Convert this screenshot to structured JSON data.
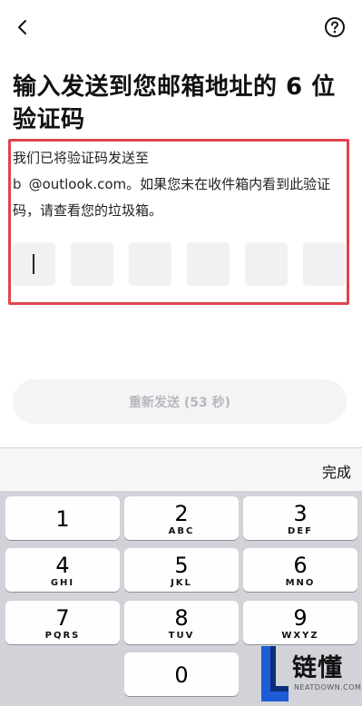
{
  "header": {
    "back_icon": "chevron-left-icon",
    "help_icon": "question-circle-icon"
  },
  "title": "输入发送到您邮箱地址的 6 位验证码",
  "description": {
    "line1": "我们已将验证码发送至",
    "email_masked": "b      ",
    "email_domain": "@outlook.com",
    "rest": "。如果您未在收件箱内看到此验证码，请查看您的垃圾箱。"
  },
  "code": {
    "length": 6,
    "values": [
      "",
      "",
      "",
      "",
      "",
      ""
    ]
  },
  "resend_button": "重新发送 (53 秒)",
  "keyboard": {
    "done": "完成",
    "keys": [
      {
        "num": "1",
        "letters": ""
      },
      {
        "num": "2",
        "letters": "ABC"
      },
      {
        "num": "3",
        "letters": "DEF"
      },
      {
        "num": "4",
        "letters": "GHI"
      },
      {
        "num": "5",
        "letters": "JKL"
      },
      {
        "num": "6",
        "letters": "MNO"
      },
      {
        "num": "7",
        "letters": "PQRS"
      },
      {
        "num": "8",
        "letters": "TUV"
      },
      {
        "num": "9",
        "letters": "WXYZ"
      },
      {
        "num": "0",
        "letters": ""
      }
    ]
  },
  "watermark": {
    "text": "链懂",
    "sub": "NEATDOWN.COM"
  },
  "colors": {
    "highlight": "#e0454d",
    "keyboard_bg": "#d1d3d9",
    "watermark_blue": "#1e5bd6"
  }
}
